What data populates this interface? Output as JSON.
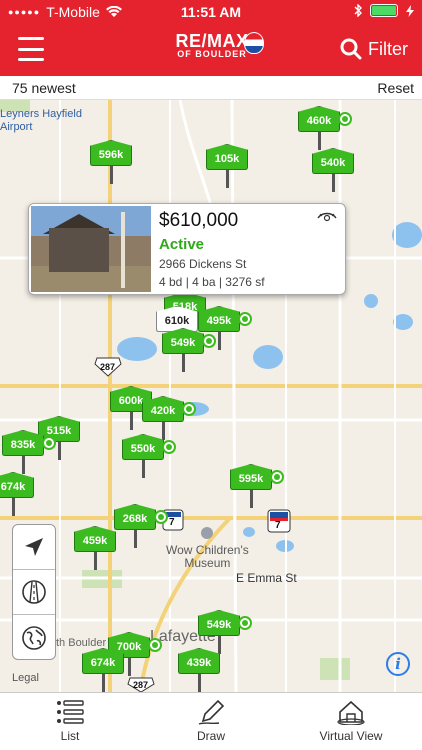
{
  "status_bar": {
    "carrier": "T-Mobile",
    "time": "11:51 AM"
  },
  "nav": {
    "logo_line1": "RE/MAX",
    "logo_line2": "OF BOULDER",
    "filter_label": "Filter"
  },
  "subbar": {
    "count_label": "75 newest",
    "reset_label": "Reset"
  },
  "map": {
    "labels": {
      "airport": "Leyners Hayfield\nAirport",
      "museum": "Wow Children's\nMuseum",
      "street": "E Emma St",
      "town": "Lafayette",
      "boulder": "th Boulder",
      "legal": "Legal",
      "route287a": "287",
      "route287b": "287",
      "route7a": "7",
      "route7b": "7"
    },
    "pins": [
      {
        "label": "596k"
      },
      {
        "label": "460k"
      },
      {
        "label": "105k"
      },
      {
        "label": "540k"
      },
      {
        "label": "518k"
      },
      {
        "label": "610k"
      },
      {
        "label": "495k"
      },
      {
        "label": "549k"
      },
      {
        "label": "600k"
      },
      {
        "label": "420k"
      },
      {
        "label": "515k"
      },
      {
        "label": "835k"
      },
      {
        "label": "550k"
      },
      {
        "label": "674k"
      },
      {
        "label": "595k"
      },
      {
        "label": "268k"
      },
      {
        "label": "459k"
      },
      {
        "label": "549k"
      },
      {
        "label": "700k"
      },
      {
        "label": "674k"
      },
      {
        "label": "439k"
      }
    ]
  },
  "listing_card": {
    "price": "$610,000",
    "status": "Active",
    "address": "2966 Dickens St",
    "details": "4 bd | 4 ba | 3276 sf"
  },
  "tabbar": {
    "list_label": "List",
    "draw_label": "Draw",
    "virtual_label": "Virtual View"
  },
  "colors": {
    "brand_red": "#e4232e",
    "pin_green": "#3cbb20",
    "active_green": "#2fa81a"
  }
}
